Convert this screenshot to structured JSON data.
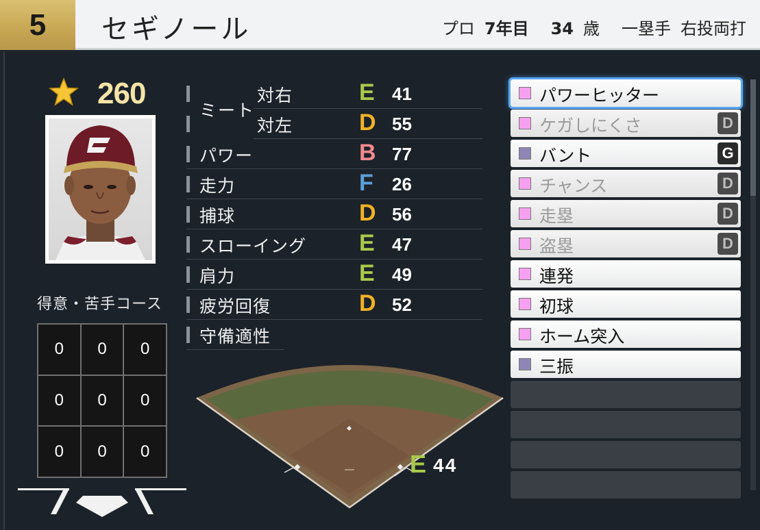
{
  "header": {
    "number": "5",
    "name": "セギノール",
    "pro_label": "プロ",
    "years": "7年目",
    "age": "34",
    "age_unit": "歳",
    "position": "一塁手",
    "throw_bat": "右投両打"
  },
  "overall": {
    "value": "260",
    "icon": "star-icon"
  },
  "stats": {
    "meet_label": "ミート",
    "meet_right_label": "対右",
    "meet_right_grade": "E",
    "meet_right_value": "41",
    "meet_left_label": "対左",
    "meet_left_grade": "D",
    "meet_left_value": "55",
    "power_label": "パワー",
    "power_grade": "B",
    "power_value": "77",
    "speed_label": "走力",
    "speed_grade": "F",
    "speed_value": "26",
    "catch_label": "捕球",
    "catch_grade": "D",
    "catch_value": "56",
    "throw_label": "スローイング",
    "throw_grade": "E",
    "throw_value": "47",
    "arm_label": "肩力",
    "arm_grade": "E",
    "arm_value": "49",
    "recovery_label": "疲労回復",
    "recovery_grade": "D",
    "recovery_value": "52",
    "defense_label": "守備適性"
  },
  "defense": {
    "grade": "E",
    "value": "44"
  },
  "course": {
    "title": "得意・苦手コース",
    "cells": [
      "0",
      "0",
      "0",
      "0",
      "0",
      "0",
      "0",
      "0",
      "0"
    ]
  },
  "abilities": [
    {
      "name": "パワーヒッター",
      "badge": "",
      "square_color": "#f5a0f0",
      "dim": false,
      "selected": true
    },
    {
      "name": "ケガしにくさ",
      "badge": "D",
      "square_color": "#f5a0f0",
      "dim": true,
      "selected": false
    },
    {
      "name": "バント",
      "badge": "G",
      "square_color": "#8f86b6",
      "dim": false,
      "selected": false
    },
    {
      "name": "チャンス",
      "badge": "D",
      "square_color": "#f5a0f0",
      "dim": true,
      "selected": false
    },
    {
      "name": "走塁",
      "badge": "D",
      "square_color": "#f5a0f0",
      "dim": true,
      "selected": false
    },
    {
      "name": "盗塁",
      "badge": "D",
      "square_color": "#f5a0f0",
      "dim": true,
      "selected": false
    },
    {
      "name": "連発",
      "badge": "",
      "square_color": "#f5a0f0",
      "dim": false,
      "selected": false
    },
    {
      "name": "初球",
      "badge": "",
      "square_color": "#f5a0f0",
      "dim": false,
      "selected": false
    },
    {
      "name": "ホーム突入",
      "badge": "",
      "square_color": "#f5a0f0",
      "dim": false,
      "selected": false
    },
    {
      "name": "三振",
      "badge": "",
      "square_color": "#8f86b6",
      "dim": false,
      "selected": false
    }
  ],
  "empty_ability_slots": 4,
  "colors": {
    "grade_E": "#a9c94a",
    "grade_D": "#f0b226",
    "grade_B": "#f08a8f",
    "grade_F": "#5c9fd8",
    "gold": "#c9a955",
    "selected_outline": "#5aa7f0"
  }
}
